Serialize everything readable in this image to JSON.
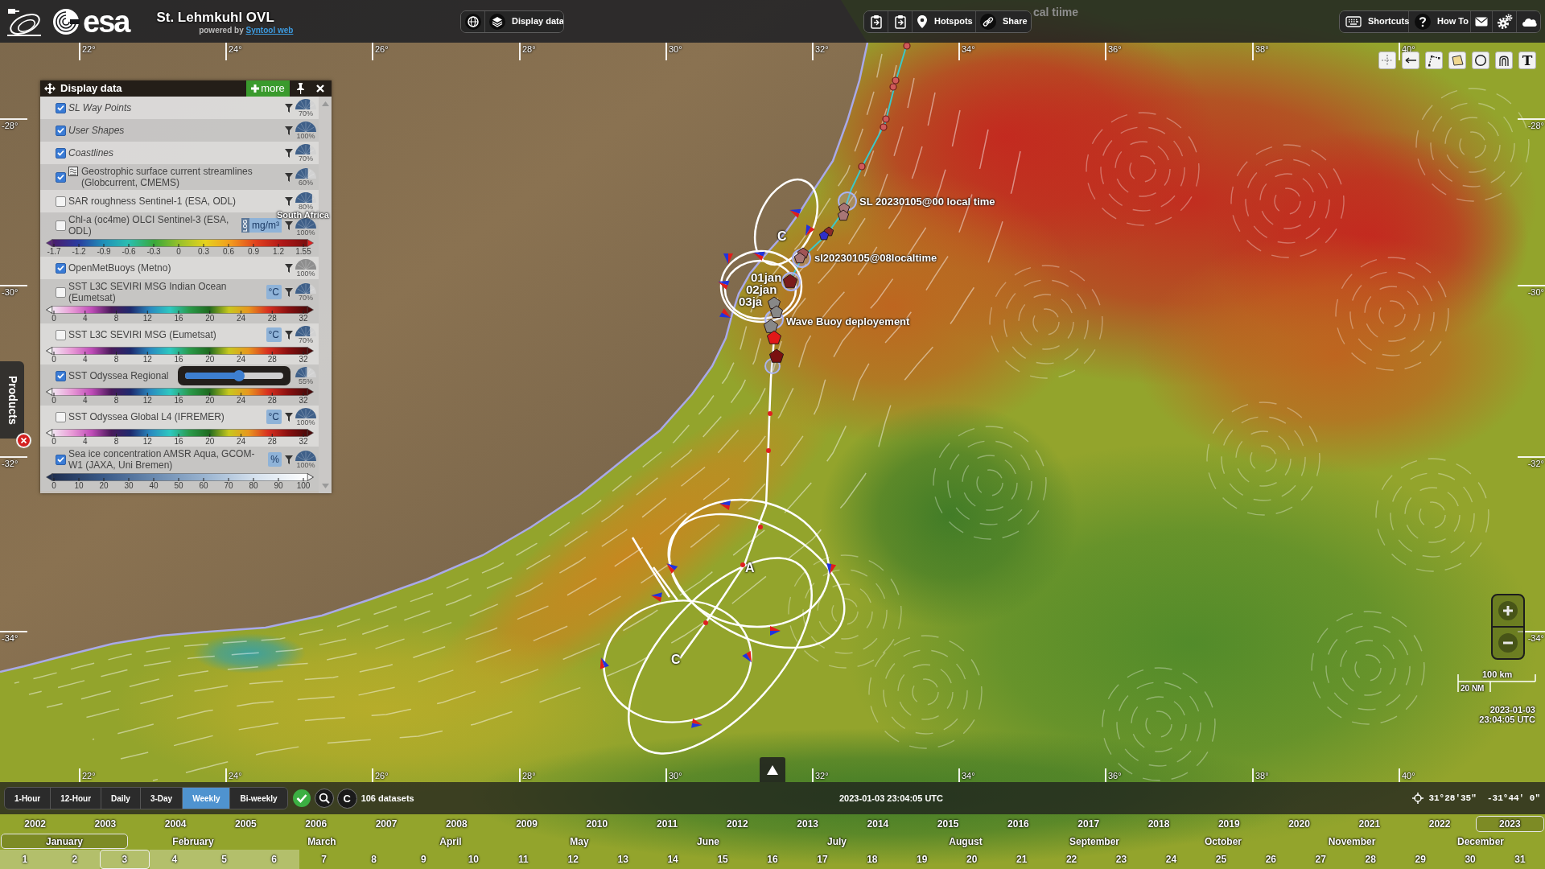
{
  "top_bar": {
    "logo_text": "esa",
    "title": "St. Lehmkuhl OVL",
    "powered_by": "powered by",
    "powered_by_link": "Syntool web",
    "view_buttons": [
      "Display data"
    ],
    "map_buttons": [
      "Hotspots",
      "Share"
    ],
    "help_buttons": [
      "Shortcuts",
      "How To"
    ]
  },
  "map": {
    "hidden_label": "cal tiime",
    "lon_ticks_top": [
      "22°",
      "24°",
      "26°",
      "28°",
      "30°",
      "32°",
      "34°",
      "36°",
      "38°",
      "40°"
    ],
    "lat_ticks_left": [
      "-28°",
      "-30°",
      "-32°",
      "-34°"
    ],
    "lat_ticks_right": [
      "-28°",
      "-30°",
      "-32°",
      "-34°"
    ],
    "lon_ticks_bottom": [
      "22°",
      "24°",
      "26°",
      "28°",
      "30°",
      "32°",
      "34°",
      "36°",
      "38°",
      "40°"
    ],
    "region_label": "South Africa",
    "track_labels": [
      {
        "text": "SL 20230105@00 local time",
        "kind": "waypoint"
      },
      {
        "text": "sl20230105@08localtime",
        "kind": "waypoint"
      },
      {
        "text": "01jan",
        "kind": "day"
      },
      {
        "text": "02jan",
        "kind": "day"
      },
      {
        "text": "03ja",
        "kind": "day"
      },
      {
        "text": "Wave Buoy deployement",
        "kind": "waypoint"
      }
    ],
    "loop_labels": [
      "C",
      "A",
      "C"
    ],
    "text_tool": "T",
    "scale_km": "100 km",
    "scale_nm": "20 NM",
    "date": "2023-01-03",
    "time": "23:04:05 UTC"
  },
  "display_panel": {
    "title": "Display data",
    "more_button": "more",
    "layers": [
      {
        "label": "SL Way Points",
        "kind": "user",
        "checked": true,
        "legend_icon": false,
        "slider_open": false,
        "gauge_disabled": false,
        "opacity": "70%",
        "level": 0.7
      },
      {
        "label": "User Shapes",
        "kind": "user",
        "checked": true,
        "legend_icon": false,
        "slider_open": false,
        "gauge_disabled": false,
        "opacity": "100%",
        "level": 1
      },
      {
        "label": "Coastlines",
        "kind": "user",
        "checked": true,
        "legend_icon": false,
        "slider_open": false,
        "gauge_disabled": false,
        "opacity": "70%",
        "level": 0.7
      },
      {
        "label": "Geostrophic surface current streamlines (Globcurrent, CMEMS)",
        "kind": "dataset",
        "checked": true,
        "legend_icon": true,
        "slider_open": false,
        "gauge_disabled": false,
        "opacity": "60%",
        "level": 0.6
      },
      {
        "label": "SAR roughness Sentinel-1 (ESA, ODL)",
        "kind": "dataset",
        "checked": false,
        "legend_icon": false,
        "slider_open": false,
        "gauge_disabled": false,
        "opacity": "80%",
        "level": 0.8
      },
      {
        "label": "Chl-a (oc4me) OLCI Sentinel-3 (ESA, ODL)",
        "kind": "dataset",
        "checked": false,
        "legend_icon": false,
        "slider_open": false,
        "gauge_disabled": false,
        "scale_tag": "LOG",
        "unit": "mg/m³",
        "opacity": "100%",
        "level": 1,
        "colorbar": {
          "kind": "chl",
          "ticks": [
            "-1.7",
            "-1.2",
            "-0.9",
            "-0.6",
            "-0.3",
            "0",
            "0.3",
            "0.6",
            "0.9",
            "1.2",
            "1.55"
          ]
        }
      },
      {
        "label": "OpenMetBuoys (Metno)",
        "kind": "dataset",
        "checked": true,
        "legend_icon": false,
        "slider_open": false,
        "gauge_disabled": true,
        "opacity": "100%",
        "level": 1
      },
      {
        "label": "SST L3C SEVIRI MSG Indian Ocean (Eumetsat)",
        "kind": "dataset",
        "checked": false,
        "legend_icon": false,
        "slider_open": false,
        "gauge_disabled": false,
        "unit": "°C",
        "opacity": "70%",
        "level": 0.7,
        "colorbar": {
          "kind": "sst",
          "ticks": [
            "0",
            "4",
            "8",
            "12",
            "16",
            "20",
            "24",
            "28",
            "32"
          ]
        }
      },
      {
        "label": "SST L3C SEVIRI MSG (Eumetsat)",
        "kind": "dataset",
        "checked": false,
        "legend_icon": false,
        "slider_open": false,
        "gauge_disabled": false,
        "unit": "°C",
        "opacity": "70%",
        "level": 0.7,
        "colorbar": {
          "kind": "sst",
          "ticks": [
            "0",
            "4",
            "8",
            "12",
            "16",
            "20",
            "24",
            "28",
            "32"
          ]
        }
      },
      {
        "label": "SST Odyssea Regional",
        "kind": "dataset",
        "checked": true,
        "legend_icon": false,
        "slider_open": true,
        "gauge_disabled": false,
        "opacity": "55%",
        "level": 0.55,
        "colorbar": {
          "kind": "sst",
          "ticks": [
            "0",
            "4",
            "8",
            "12",
            "16",
            "20",
            "24",
            "28",
            "32"
          ]
        }
      },
      {
        "label": "SST Odyssea Global L4 (IFREMER)",
        "kind": "dataset",
        "checked": false,
        "legend_icon": false,
        "slider_open": false,
        "gauge_disabled": false,
        "unit": "°C",
        "opacity": "100%",
        "level": 1,
        "colorbar": {
          "kind": "sst",
          "ticks": [
            "0",
            "4",
            "8",
            "12",
            "16",
            "20",
            "24",
            "28",
            "32"
          ]
        }
      },
      {
        "label": "Sea ice concentration AMSR Aqua, GCOM-W1 (JAXA, Uni Bremen)",
        "kind": "dataset",
        "checked": true,
        "legend_icon": false,
        "slider_open": false,
        "gauge_disabled": false,
        "unit": "%",
        "opacity": "100%",
        "level": 1,
        "colorbar": {
          "kind": "ice",
          "ticks": [
            "0",
            "10",
            "20",
            "30",
            "40",
            "50",
            "60",
            "70",
            "80",
            "90",
            "100"
          ]
        }
      }
    ]
  },
  "products_tab": "Products",
  "bottom_bar": {
    "periods": [
      {
        "label": "1-Hour",
        "selected": false
      },
      {
        "label": "12-Hour",
        "selected": false
      },
      {
        "label": "Daily",
        "selected": false
      },
      {
        "label": "3-Day",
        "selected": false
      },
      {
        "label": "Weekly",
        "selected": true
      },
      {
        "label": "Bi-weekly",
        "selected": false
      }
    ],
    "reset_button": "C",
    "datasets": "106 datasets",
    "current_time": "2023-01-03 23:04:05 UTC",
    "coordinates": "31°28'35\"  -31°44' 0\""
  },
  "timeline": {
    "years": [
      {
        "label": "2002",
        "selected": false
      },
      {
        "label": "2003",
        "selected": false
      },
      {
        "label": "2004",
        "selected": false
      },
      {
        "label": "2005",
        "selected": false
      },
      {
        "label": "2006",
        "selected": false
      },
      {
        "label": "2007",
        "selected": false
      },
      {
        "label": "2008",
        "selected": false
      },
      {
        "label": "2009",
        "selected": false
      },
      {
        "label": "2010",
        "selected": false
      },
      {
        "label": "2011",
        "selected": false
      },
      {
        "label": "2012",
        "selected": false
      },
      {
        "label": "2013",
        "selected": false
      },
      {
        "label": "2014",
        "selected": false
      },
      {
        "label": "2015",
        "selected": false
      },
      {
        "label": "2016",
        "selected": false
      },
      {
        "label": "2017",
        "selected": false
      },
      {
        "label": "2018",
        "selected": false
      },
      {
        "label": "2019",
        "selected": false
      },
      {
        "label": "2020",
        "selected": false
      },
      {
        "label": "2021",
        "selected": false
      },
      {
        "label": "2022",
        "selected": false
      },
      {
        "label": "2023",
        "selected": true
      }
    ],
    "months": [
      {
        "label": "January",
        "selected": true
      },
      {
        "label": "February",
        "selected": false
      },
      {
        "label": "March",
        "selected": false
      },
      {
        "label": "April",
        "selected": false
      },
      {
        "label": "May",
        "selected": false
      },
      {
        "label": "June",
        "selected": false
      },
      {
        "label": "July",
        "selected": false
      },
      {
        "label": "August",
        "selected": false
      },
      {
        "label": "September",
        "selected": false
      },
      {
        "label": "October",
        "selected": false
      },
      {
        "label": "November",
        "selected": false
      },
      {
        "label": "December",
        "selected": false
      }
    ],
    "days": [
      {
        "label": "1",
        "selected": false,
        "in_range": true
      },
      {
        "label": "2",
        "selected": false,
        "in_range": true
      },
      {
        "label": "3",
        "selected": true,
        "in_range": true
      },
      {
        "label": "4",
        "selected": false,
        "in_range": true
      },
      {
        "label": "5",
        "selected": false,
        "in_range": true
      },
      {
        "label": "6",
        "selected": false,
        "in_range": true
      },
      {
        "label": "7",
        "selected": false,
        "in_range": false
      },
      {
        "label": "8",
        "selected": false,
        "in_range": false
      },
      {
        "label": "9",
        "selected": false,
        "in_range": false
      },
      {
        "label": "10",
        "selected": false,
        "in_range": false
      },
      {
        "label": "11",
        "selected": false,
        "in_range": false
      },
      {
        "label": "12",
        "selected": false,
        "in_range": false
      },
      {
        "label": "13",
        "selected": false,
        "in_range": false
      },
      {
        "label": "14",
        "selected": false,
        "in_range": false
      },
      {
        "label": "15",
        "selected": false,
        "in_range": false
      },
      {
        "label": "16",
        "selected": false,
        "in_range": false
      },
      {
        "label": "17",
        "selected": false,
        "in_range": false
      },
      {
        "label": "18",
        "selected": false,
        "in_range": false
      },
      {
        "label": "19",
        "selected": false,
        "in_range": false
      },
      {
        "label": "20",
        "selected": false,
        "in_range": false
      },
      {
        "label": "21",
        "selected": false,
        "in_range": false
      },
      {
        "label": "22",
        "selected": false,
        "in_range": false
      },
      {
        "label": "23",
        "selected": false,
        "in_range": false
      },
      {
        "label": "24",
        "selected": false,
        "in_range": false
      },
      {
        "label": "25",
        "selected": false,
        "in_range": false
      },
      {
        "label": "26",
        "selected": false,
        "in_range": false
      },
      {
        "label": "27",
        "selected": false,
        "in_range": false
      },
      {
        "label": "28",
        "selected": false,
        "in_range": false
      },
      {
        "label": "29",
        "selected": false,
        "in_range": false
      },
      {
        "label": "30",
        "selected": false,
        "in_range": false
      },
      {
        "label": "31",
        "selected": false,
        "in_range": false
      }
    ]
  }
}
